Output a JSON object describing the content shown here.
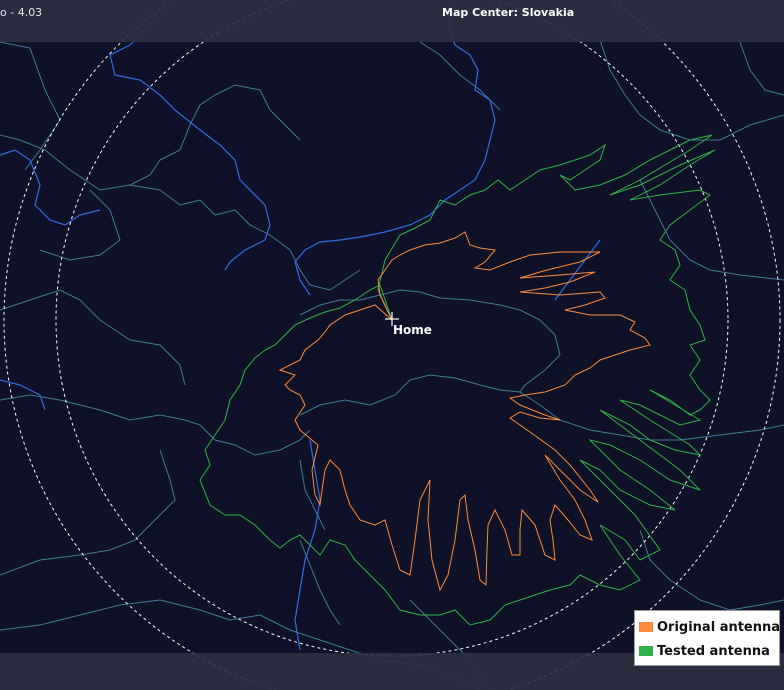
{
  "header": {
    "version": "o - 4.03",
    "map_center": "Map Center: Slovakia"
  },
  "map": {
    "home_label": "Home",
    "background_color": "#0e1127",
    "border_color_country": "#3f7c96",
    "border_color_river": "#2f6fe0",
    "range_ring_color": "#ffffff"
  },
  "legend": {
    "items": [
      {
        "label": "Original antenna",
        "color": "#ff8a3d"
      },
      {
        "label": "Tested antenna",
        "color": "#2fb24a"
      }
    ]
  }
}
